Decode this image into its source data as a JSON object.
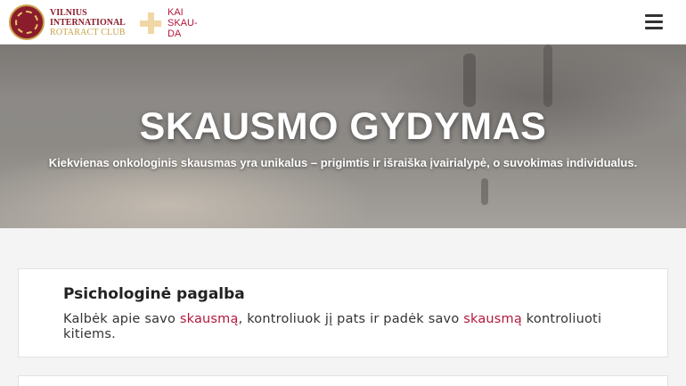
{
  "header": {
    "rotary_logo": {
      "line1": "VILNIUS",
      "line2": "INTERNATIONAL",
      "line3": "ROTARACT CLUB"
    },
    "kai_logo": {
      "line1": "KAI",
      "line2": "SKAU-",
      "line3": "DA"
    },
    "menu_icon": "hamburger-menu-icon"
  },
  "hero": {
    "title": "SKAUSMO GYDYMAS",
    "subtitle": "Kiekvienas onkologinis skausmas yra unikalus – prigimtis ir išraiška įvairialypė, o suvokimas individualus."
  },
  "cards": [
    {
      "title": "Psichologinė pagalba",
      "body": {
        "part1": "Kalbėk apie savo ",
        "link1": "skausmą",
        "part2": ", kontroliuok jį pats ir padėk savo ",
        "link2": "skausmą",
        "part3": " kontroliuoti kitiems."
      }
    }
  ],
  "colors": {
    "brand_maroon": "#8b1c2c",
    "brand_gold": "#c9a24a",
    "link_red": "#b3173c",
    "cross_beige": "#f1d7a5"
  }
}
